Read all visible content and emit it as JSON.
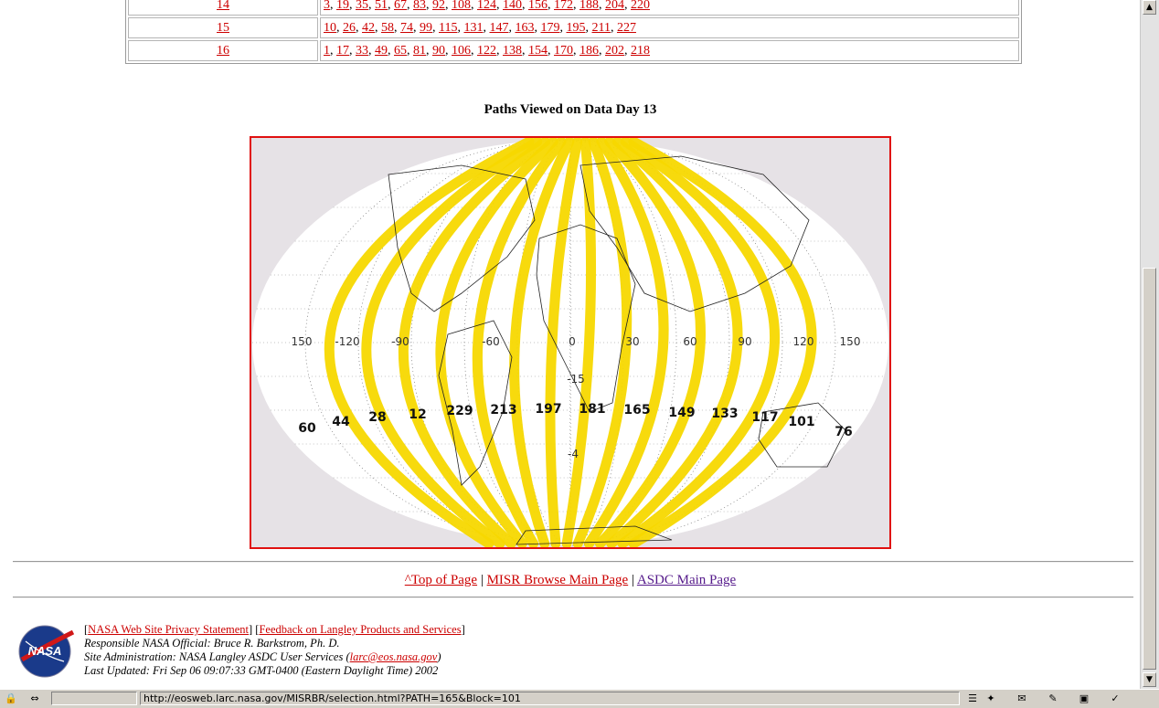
{
  "table": {
    "rows": [
      {
        "day": "14",
        "paths": [
          "3",
          "19",
          "35",
          "51",
          "67",
          "83",
          "92",
          "108",
          "124",
          "140",
          "156",
          "172",
          "188",
          "204",
          "220"
        ]
      },
      {
        "day": "15",
        "paths": [
          "10",
          "26",
          "42",
          "58",
          "74",
          "99",
          "115",
          "131",
          "147",
          "163",
          "179",
          "195",
          "211",
          "227"
        ]
      },
      {
        "day": "16",
        "paths": [
          "1",
          "17",
          "33",
          "49",
          "65",
          "81",
          "90",
          "106",
          "122",
          "138",
          "154",
          "170",
          "186",
          "202",
          "218"
        ]
      }
    ]
  },
  "heading": "Paths Viewed on Data Day 13",
  "map": {
    "path_labels": [
      "60",
      "44",
      "28",
      "12",
      "229",
      "213",
      "197",
      "181",
      "165",
      "149",
      "133",
      "117",
      "101",
      "76"
    ],
    "longitude_labels": [
      "150",
      "-120",
      "-90",
      "-60",
      "0",
      "30",
      "60",
      "90",
      "120",
      "150"
    ],
    "latitude_labels": [
      "-15",
      "-4"
    ],
    "colors": {
      "swath": "#f7d800",
      "frame": "#e01010",
      "background": "#e6e2e6"
    }
  },
  "nav": {
    "top_link": "^Top of Page",
    "sep1": "|",
    "browse_link": "MISR Browse Main Page",
    "sep2": "|",
    "asdc_link": "ASDC Main Page"
  },
  "footer": {
    "logo_text": "NASA",
    "privacy_link": "NASA Web Site Privacy Statement",
    "feedback_link": "Feedback on Langley Products and Services",
    "official": "Responsible NASA Official: Bruce R. Barkstrom, Ph. D.",
    "admin_prefix": "Site Administration: NASA Langley ASDC User Services (",
    "admin_email": "larc@eos.nasa.gov",
    "admin_suffix": ")",
    "updated": "Last Updated: Fri Sep 06 09:07:33 GMT-0400 (Eastern Daylight Time) 2002"
  },
  "status_bar": {
    "url": "http://eosweb.larc.nasa.gov/MISRBR/selection.html?PATH=165&Block=101"
  }
}
